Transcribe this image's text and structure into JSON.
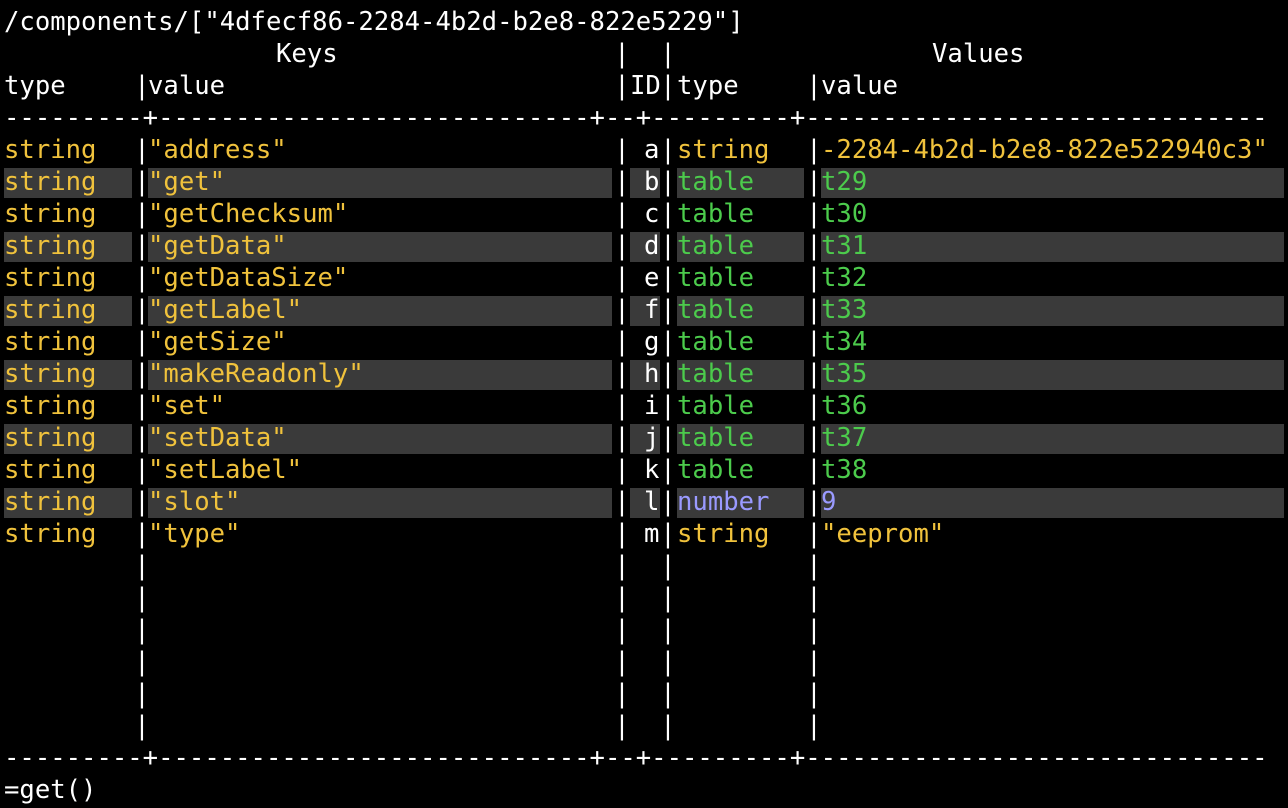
{
  "path": "/components/[\"4dfecf86-2284-4b2d-b2e8-822e5229\"]",
  "headers": {
    "keys": "Keys",
    "values": "Values",
    "key_type": "type",
    "key_value": "value",
    "id": "ID",
    "val_type": "type",
    "val_value": "value"
  },
  "dash_line": "---------+----------------------------+--+---------+------------------------------",
  "colors": {
    "string": "#f0c23c",
    "table": "#4ccb4c",
    "number": "#9a9aff",
    "highlight": "#3a3a3a",
    "text": "#ffffff"
  },
  "rows": [
    {
      "key_type": "string",
      "key_value": "\"address\"",
      "id": "a",
      "val_type": "string",
      "val_value": "-2284-4b2d-b2e8-822e522940c3\""
    },
    {
      "key_type": "string",
      "key_value": "\"get\"",
      "id": "b",
      "val_type": "table",
      "val_value": "t29"
    },
    {
      "key_type": "string",
      "key_value": "\"getChecksum\"",
      "id": "c",
      "val_type": "table",
      "val_value": "t30"
    },
    {
      "key_type": "string",
      "key_value": "\"getData\"",
      "id": "d",
      "val_type": "table",
      "val_value": "t31"
    },
    {
      "key_type": "string",
      "key_value": "\"getDataSize\"",
      "id": "e",
      "val_type": "table",
      "val_value": "t32"
    },
    {
      "key_type": "string",
      "key_value": "\"getLabel\"",
      "id": "f",
      "val_type": "table",
      "val_value": "t33"
    },
    {
      "key_type": "string",
      "key_value": "\"getSize\"",
      "id": "g",
      "val_type": "table",
      "val_value": "t34"
    },
    {
      "key_type": "string",
      "key_value": "\"makeReadonly\"",
      "id": "h",
      "val_type": "table",
      "val_value": "t35"
    },
    {
      "key_type": "string",
      "key_value": "\"set\"",
      "id": "i",
      "val_type": "table",
      "val_value": "t36"
    },
    {
      "key_type": "string",
      "key_value": "\"setData\"",
      "id": "j",
      "val_type": "table",
      "val_value": "t37"
    },
    {
      "key_type": "string",
      "key_value": "\"setLabel\"",
      "id": "k",
      "val_type": "table",
      "val_value": "t38"
    },
    {
      "key_type": "string",
      "key_value": "\"slot\"",
      "id": "l",
      "val_type": "number",
      "val_value": "9"
    },
    {
      "key_type": "string",
      "key_value": "\"type\"",
      "id": "m",
      "val_type": "string",
      "val_value": "\"eeprom\""
    }
  ],
  "command": "=get()"
}
